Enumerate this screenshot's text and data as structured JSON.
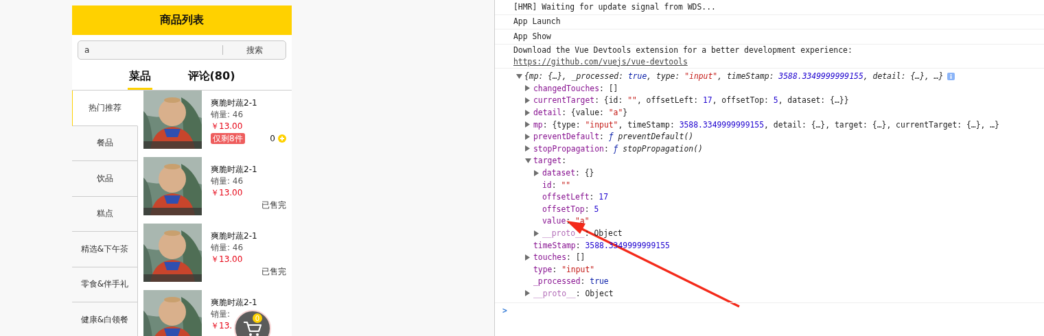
{
  "app": {
    "title": "商品列表",
    "search": {
      "value": "a",
      "button": "搜索"
    },
    "tabs": [
      {
        "label": "菜品",
        "selected": true
      },
      {
        "label": "评论(80)",
        "selected": false
      }
    ],
    "categories": [
      {
        "label": "热门推荐",
        "selected": true
      },
      {
        "label": "餐品",
        "selected": false
      },
      {
        "label": "饮品",
        "selected": false
      },
      {
        "label": "糕点",
        "selected": false
      },
      {
        "label": "精选&下午茶",
        "selected": false
      },
      {
        "label": "零食&伴手礼",
        "selected": false
      },
      {
        "label": "健康&白领餐",
        "selected": false
      }
    ],
    "products": [
      {
        "kind": "available",
        "name": "爽脆时蔬2-1",
        "sales": "销量: 46",
        "price": "￥13.00",
        "badge": "仅剩8件",
        "quantity": "0"
      },
      {
        "kind": "sold_out",
        "name": "爽脆时蔬2-1",
        "sales": "销量: 46",
        "price": "￥13.00",
        "status": "已售完"
      },
      {
        "kind": "sold_out",
        "name": "爽脆时蔬2-1",
        "sales": "销量: 46",
        "price": "￥13.00",
        "status": "已售完"
      },
      {
        "kind": "partial",
        "name": "爽脆时蔬2-1",
        "sales": "销量:",
        "price": "￥13."
      }
    ],
    "cart": {
      "count": "0"
    }
  },
  "console": {
    "messages": [
      {
        "text": "[HMR] Waiting for update signal from WDS..."
      },
      {
        "text": "App Launch"
      },
      {
        "text": "App Show"
      },
      {
        "text": "Download the Vue Devtools extension for a better development experience:",
        "link": "https://github.com/vuejs/vue-devtools"
      }
    ],
    "tree": {
      "kind": "root",
      "expanded": true,
      "tokens": [
        {
          "text": "{mp: {…}, _processed: ",
          "kind": "plain"
        },
        {
          "text": "true",
          "kind": "keyword"
        },
        {
          "text": ", type: ",
          "kind": "plain"
        },
        {
          "text": "\"input\"",
          "kind": "string"
        },
        {
          "text": ", timeStamp: ",
          "kind": "plain"
        },
        {
          "text": "3588.3349999999155",
          "kind": "number"
        },
        {
          "text": ", detail: {…}, …}",
          "kind": "plain"
        }
      ],
      "children": [
        {
          "kind": "prop",
          "key": "changedTouches",
          "expanded": false,
          "tokens": [
            {
              "text": ": []",
              "kind": "plain"
            }
          ]
        },
        {
          "kind": "prop",
          "key": "currentTarget",
          "expanded": false,
          "tokens": [
            {
              "text": ": {id: ",
              "kind": "plain"
            },
            {
              "text": "\"\"",
              "kind": "string"
            },
            {
              "text": ", offsetLeft: ",
              "kind": "plain"
            },
            {
              "text": "17",
              "kind": "number"
            },
            {
              "text": ", offsetTop: ",
              "kind": "plain"
            },
            {
              "text": "5",
              "kind": "number"
            },
            {
              "text": ", dataset: {…}}",
              "kind": "plain"
            }
          ]
        },
        {
          "kind": "prop",
          "key": "detail",
          "expanded": false,
          "tokens": [
            {
              "text": ": {value: ",
              "kind": "plain"
            },
            {
              "text": "\"a\"",
              "kind": "string"
            },
            {
              "text": "}",
              "kind": "plain"
            }
          ]
        },
        {
          "kind": "prop",
          "key": "mp",
          "expanded": false,
          "tokens": [
            {
              "text": ": {type: ",
              "kind": "plain"
            },
            {
              "text": "\"input\"",
              "kind": "string"
            },
            {
              "text": ", timeStamp: ",
              "kind": "plain"
            },
            {
              "text": "3588.3349999999155",
              "kind": "number"
            },
            {
              "text": ", detail: {…}, target: {…}, currentTarget: {…}, …}",
              "kind": "plain"
            }
          ]
        },
        {
          "kind": "prop",
          "key": "preventDefault",
          "expanded": false,
          "tokens": [
            {
              "text": ": ",
              "kind": "plain"
            },
            {
              "text": "ƒ",
              "kind": "func"
            },
            {
              "text": " preventDefault()",
              "kind": "fname"
            }
          ]
        },
        {
          "kind": "prop",
          "key": "stopPropagation",
          "expanded": false,
          "tokens": [
            {
              "text": ": ",
              "kind": "plain"
            },
            {
              "text": "ƒ",
              "kind": "func"
            },
            {
              "text": " stopPropagation()",
              "kind": "fname"
            }
          ]
        },
        {
          "kind": "prop",
          "key": "target",
          "expanded": true,
          "tokens": [
            {
              "text": ":",
              "kind": "plain"
            }
          ],
          "children": [
            {
              "kind": "prop",
              "key": "dataset",
              "expanded": false,
              "tokens": [
                {
                  "text": ": {}",
                  "kind": "plain"
                }
              ]
            },
            {
              "kind": "prop",
              "key": "id",
              "tokens": [
                {
                  "text": ": ",
                  "kind": "plain"
                },
                {
                  "text": "\"\"",
                  "kind": "string"
                }
              ]
            },
            {
              "kind": "prop",
              "key": "offsetLeft",
              "tokens": [
                {
                  "text": ": ",
                  "kind": "plain"
                },
                {
                  "text": "17",
                  "kind": "number"
                }
              ]
            },
            {
              "kind": "prop",
              "key": "offsetTop",
              "tokens": [
                {
                  "text": ": ",
                  "kind": "plain"
                },
                {
                  "text": "5",
                  "kind": "number"
                }
              ]
            },
            {
              "kind": "prop",
              "key": "value",
              "tokens": [
                {
                  "text": ": ",
                  "kind": "plain"
                },
                {
                  "text": "\"a\"",
                  "kind": "string"
                }
              ]
            },
            {
              "kind": "proto",
              "key": "__proto__",
              "expanded": false,
              "tokens": [
                {
                  "text": ": Object",
                  "kind": "plain"
                }
              ]
            }
          ]
        },
        {
          "kind": "prop",
          "key": "timeStamp",
          "tokens": [
            {
              "text": ": ",
              "kind": "plain"
            },
            {
              "text": "3588.3349999999155",
              "kind": "number"
            }
          ]
        },
        {
          "kind": "prop",
          "key": "touches",
          "expanded": false,
          "tokens": [
            {
              "text": ": []",
              "kind": "plain"
            }
          ]
        },
        {
          "kind": "prop",
          "key": "type",
          "tokens": [
            {
              "text": ": ",
              "kind": "plain"
            },
            {
              "text": "\"input\"",
              "kind": "string"
            }
          ]
        },
        {
          "kind": "prop",
          "key": "_processed",
          "tokens": [
            {
              "text": ": ",
              "kind": "plain"
            },
            {
              "text": "true",
              "kind": "keyword"
            }
          ]
        },
        {
          "kind": "proto",
          "key": "__proto__",
          "expanded": false,
          "tokens": [
            {
              "text": ": Object",
              "kind": "plain"
            }
          ]
        }
      ]
    },
    "prompt": ">"
  }
}
